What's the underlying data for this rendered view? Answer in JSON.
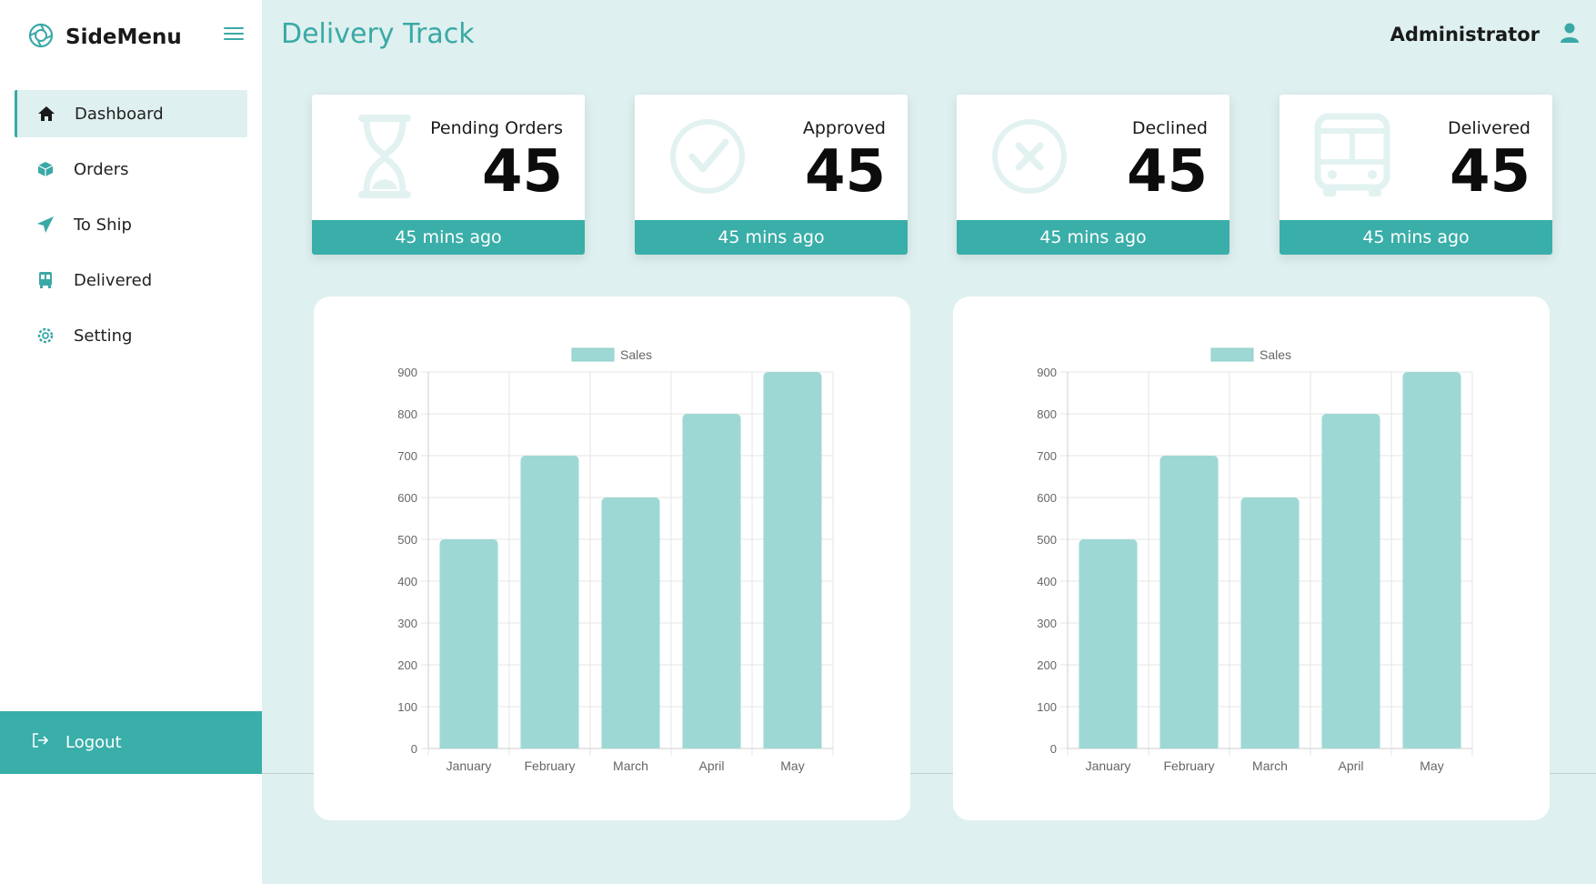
{
  "sidebar": {
    "brand": "SideMenu",
    "items": [
      {
        "label": "Dashboard",
        "icon": "home-icon",
        "active": true
      },
      {
        "label": "Orders",
        "icon": "cube-icon"
      },
      {
        "label": "To Ship",
        "icon": "paper-plane-icon"
      },
      {
        "label": "Delivered",
        "icon": "bus-icon"
      },
      {
        "label": "Setting",
        "icon": "gear-icon"
      }
    ],
    "logout": "Logout"
  },
  "header": {
    "title": "Delivery Track",
    "user": "Administrator"
  },
  "cards": [
    {
      "label": "Pending Orders",
      "value": "45",
      "footer": "45 mins ago",
      "icon": "hourglass-icon"
    },
    {
      "label": "Approved",
      "value": "45",
      "footer": "45 mins ago",
      "icon": "check-circle-icon"
    },
    {
      "label": "Declined",
      "value": "45",
      "footer": "45 mins ago",
      "icon": "x-circle-icon"
    },
    {
      "label": "Delivered",
      "value": "45",
      "footer": "45 mins ago",
      "icon": "bus-icon"
    }
  ],
  "colors": {
    "accent": "#3aaea9",
    "background": "#def0ef",
    "bar_fill": "#9ed8d4",
    "icon_faint": "#e2f2f1"
  },
  "chart_data": [
    {
      "type": "bar",
      "categories": [
        "January",
        "February",
        "March",
        "April",
        "May"
      ],
      "series": [
        {
          "name": "Sales",
          "values": [
            500,
            700,
            600,
            800,
            900
          ]
        }
      ],
      "ylim": [
        0,
        900
      ],
      "yticks": [
        0,
        100,
        200,
        300,
        400,
        500,
        600,
        700,
        800,
        900
      ],
      "legend": "top-center",
      "grid": true
    },
    {
      "type": "bar",
      "categories": [
        "January",
        "February",
        "March",
        "April",
        "May"
      ],
      "series": [
        {
          "name": "Sales",
          "values": [
            500,
            700,
            600,
            800,
            900
          ]
        }
      ],
      "ylim": [
        0,
        900
      ],
      "yticks": [
        0,
        100,
        200,
        300,
        400,
        500,
        600,
        700,
        800,
        900
      ],
      "legend": "top-center",
      "grid": true
    }
  ]
}
